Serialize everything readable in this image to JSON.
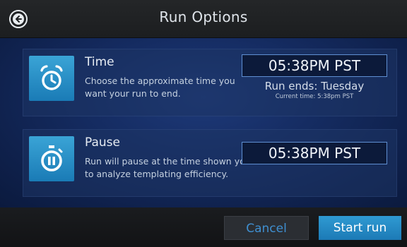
{
  "header": {
    "title": "Run Options"
  },
  "options": [
    {
      "title": "Time",
      "description": "Choose the approximate time you want your run to end.",
      "time_value": "05:38PM PST",
      "run_ends": "Run ends: Tuesday",
      "current_time": "Current time: 5:38pm PST",
      "icon": "alarm-clock-icon"
    },
    {
      "title": "Pause",
      "description": "Run will pause at the time shown you to analyze templating efficiency.",
      "time_value": "05:38PM PST",
      "icon": "stopwatch-pause-icon"
    }
  ],
  "footer": {
    "cancel_label": "Cancel",
    "start_label": "Start run"
  },
  "colors": {
    "accent": "#2a8fcf",
    "header_bg": "#202224",
    "panel_bg": "#152c62"
  }
}
